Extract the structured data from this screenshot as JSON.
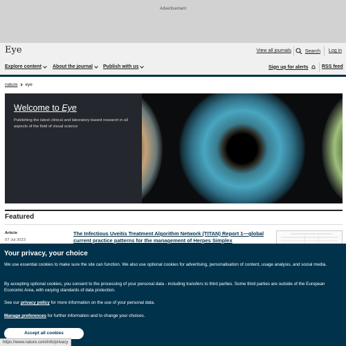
{
  "ad": {
    "label": "Advertisement"
  },
  "header": {
    "logo": "Eye",
    "view_journals": "View all journals",
    "search": "Search",
    "login": "Log in"
  },
  "nav": {
    "items": [
      "Explore content",
      "About the journal",
      "Publish with us"
    ],
    "alerts": "Sign up for alerts",
    "rss": "RSS feed"
  },
  "breadcrumb": [
    "nature",
    "eye"
  ],
  "hero": {
    "title_prefix": "Welcome to ",
    "title_em": "Eye",
    "description": "Publishing the latest clinical and laboratory-based research in all aspects of the field of visual science"
  },
  "featured": {
    "heading": "Featured",
    "article": {
      "type": "Article",
      "date": "07 Jul 2023",
      "title": "The Infectious Uveitis Treatment Algorithm Network (TITAN) Report 1—global current practice patterns for the management of Herpes Simplex"
    }
  },
  "cookie": {
    "title": "Your privacy, your choice",
    "p1": "We use essential cookies to make sure the site can function. We also use optional cookies for advertising, personalisation of content, usage analysis, and social media.",
    "p2": "By accepting optional cookies, you consent to the processing of your personal data - including transfers to third parties. Some third parties are outside of the European Economic Area, with varying standards of data protection.",
    "p3_pre": "See our ",
    "p3_link": "privacy policy",
    "p3_post": " for more information on the use of your personal data.",
    "p4_link": "Manage preferences",
    "p4_post": " for further information and to change your choices.",
    "accept": "Accept all cookies"
  },
  "status_url": "https://www.nature.com/info/privacy",
  "colors": {
    "brand_dark": "#01324b",
    "ad_bg": "#d2d2d2",
    "header_bg": "#f0f0f0"
  }
}
